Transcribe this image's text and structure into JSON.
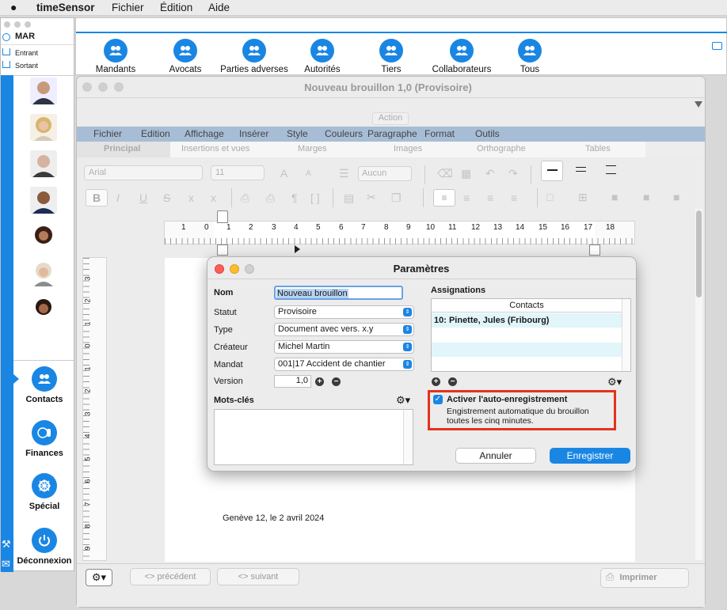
{
  "menubar": {
    "app_name": "timeSensor",
    "items": [
      "Fichier",
      "Édition",
      "Aide"
    ]
  },
  "leftpanel": {
    "date": "MAR",
    "entrant": "Entrant",
    "sortant": "Sortant",
    "nav": [
      {
        "label": "Contacts",
        "icon": "contacts-icon"
      },
      {
        "label": "Finances",
        "icon": "finances-icon"
      },
      {
        "label": "Spécial",
        "icon": "wheel-icon"
      },
      {
        "label": "Déconnexion",
        "icon": "power-icon"
      }
    ]
  },
  "toolbar": {
    "buttons": [
      "Mandants",
      "Avocats",
      "Parties adverses",
      "Autorités",
      "Tiers",
      "Collaborateurs",
      "Tous"
    ]
  },
  "docwindow": {
    "title": "Nouveau brouillon 1,0 (Provisoire)",
    "action": "Action",
    "menus": [
      "Fichier",
      "Edition",
      "Affichage",
      "Insérer",
      "Style",
      "Couleurs",
      "Paragraphe",
      "Format",
      "Outils"
    ],
    "tabs": [
      "Principal",
      "Insertions et vues",
      "Marges",
      "Images",
      "Orthographe",
      "Tables"
    ],
    "font": "Arial",
    "size": "11",
    "list_style": "Aucun",
    "ruler_numbers": [
      "1",
      "0",
      "1",
      "2",
      "3",
      "4",
      "5",
      "6",
      "7",
      "8",
      "9",
      "10",
      "11",
      "12",
      "13",
      "14",
      "15",
      "16",
      "17",
      "18"
    ],
    "vruler_numbers": [
      "3",
      "2",
      "1",
      "0",
      "1",
      "2",
      "3",
      "4",
      "5",
      "6",
      "7",
      "8",
      "9"
    ],
    "date_line": "Genève 12, le 2 avril 2024",
    "prev": "<> précédent",
    "next": "<> suivant",
    "print": "Imprimer"
  },
  "dialog": {
    "title": "Paramètres",
    "nom_label": "Nom",
    "nom_value": "Nouveau brouillon",
    "statut_label": "Statut",
    "statut_value": "Provisoire",
    "type_label": "Type",
    "type_value": "Document avec vers. x.y",
    "createur_label": "Créateur",
    "createur_value": "Michel Martin",
    "mandat_label": "Mandat",
    "mandat_value": "001|17 Accident de chantier",
    "version_label": "Version",
    "version_value": "1,0",
    "keywords_label": "Mots-clés",
    "assign_label": "Assignations",
    "contacts_header": "Contacts",
    "contacts": [
      "10: Pinette, Jules (Fribourg)"
    ],
    "autosave_label": "Activer l'auto-enregistrement",
    "autosave_checked": true,
    "autosave_desc1": "Engistrement automatique du brouillon",
    "autosave_desc2": "toutes les cinq minutes.",
    "cancel": "Annuler",
    "save": "Enregistrer"
  },
  "colors": {
    "accent": "#1a86e4",
    "highlight_box": "#e5321d"
  }
}
